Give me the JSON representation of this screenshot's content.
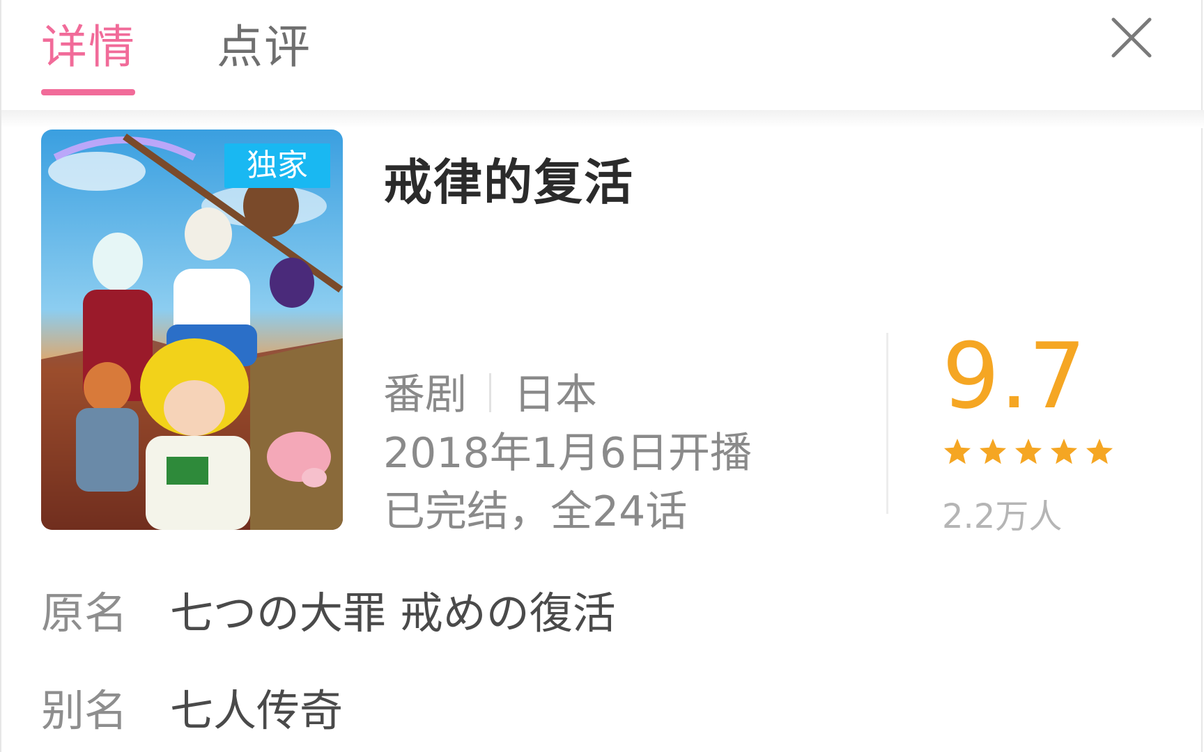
{
  "tabs": {
    "detail_label": "详情",
    "review_label": "点评",
    "active": "详情"
  },
  "close": {
    "icon": "close-icon"
  },
  "anime": {
    "badge": "独家",
    "title": "戒律的复活",
    "type": "番剧",
    "region": "日本",
    "premiere": "2018年1月6日开播",
    "status": "已完结，全24话",
    "score": "9.7",
    "stars_filled": 5,
    "stars_total": 5,
    "raters": "2.2万人"
  },
  "info": {
    "original_name_label": "原名",
    "original_name": "七つの大罪 戒めの復活",
    "alias_label": "别名",
    "alias": "七人传奇"
  },
  "colors": {
    "accent_pink": "#f16b99",
    "score_orange": "#f5a623",
    "badge_blue": "#19b8f2"
  }
}
